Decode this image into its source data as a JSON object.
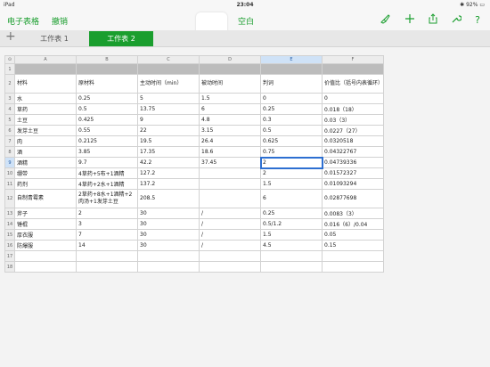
{
  "status": {
    "device": "iPad",
    "wifi": "wifi",
    "time": "23:04",
    "battery": "92%"
  },
  "toolbar": {
    "left_link": "电子表格",
    "undo": "撤销",
    "doc_title": "空白",
    "icons": [
      "brush-icon",
      "plus-icon",
      "share-icon",
      "wrench-icon",
      "help-icon"
    ]
  },
  "sheets": {
    "add": "+",
    "tabs": [
      {
        "label": "工作表 1"
      },
      {
        "label": "工作表 2"
      }
    ]
  },
  "columns": [
    "A",
    "B",
    "C",
    "D",
    "E",
    "F"
  ],
  "rows": [
    {
      "num": "1",
      "cells": [
        "",
        "",
        "",
        "",
        "",
        ""
      ]
    },
    {
      "num": "2",
      "cells": [
        "材料",
        "原材料",
        "主动时间（min）",
        "被动时间",
        "判词",
        "价值比（括号内表循环）"
      ]
    },
    {
      "num": "3",
      "cells": [
        "水",
        "0.25",
        "5",
        "1.5",
        "0",
        "0"
      ]
    },
    {
      "num": "4",
      "cells": [
        "草药",
        "0.5",
        "13.75",
        "6",
        "0.25",
        "0.018（18）"
      ]
    },
    {
      "num": "5",
      "cells": [
        "土豆",
        "0.425",
        "9",
        "4.8",
        "0.3",
        "0.03（3）"
      ]
    },
    {
      "num": "6",
      "cells": [
        "发芽土豆",
        "0.55",
        "22",
        "3.15",
        "0.5",
        "0.0227（27）"
      ]
    },
    {
      "num": "7",
      "cells": [
        "肉",
        "0.2125",
        "19.5",
        "26.4",
        "0.625",
        "0.0320518"
      ]
    },
    {
      "num": "8",
      "cells": [
        "酒",
        "3.85",
        "17.35",
        "18.6",
        "0.75",
        "0.04322767"
      ]
    },
    {
      "num": "9",
      "cells": [
        "酒精",
        "9.7",
        "42.2",
        "37.45",
        "2",
        "0.04739336"
      ]
    },
    {
      "num": "10",
      "cells": [
        "绷带",
        "4草药+5布+1酒精",
        "127.2",
        "",
        "2",
        "0.01572327"
      ]
    },
    {
      "num": "11",
      "cells": [
        "药剂",
        "4草药+2水+1酒精",
        "137.2",
        "",
        "1.5",
        "0.01093294"
      ]
    },
    {
      "num": "12",
      "cells": [
        "自制青霉素",
        "2草药+8水+1酒精+2肉汤+1发芽土豆",
        "208.5",
        "",
        "6",
        "0.02877698"
      ]
    },
    {
      "num": "13",
      "cells": [
        "斧子",
        "2",
        "30",
        "/",
        "0.25",
        "0.0083（3）"
      ]
    },
    {
      "num": "14",
      "cells": [
        "锤棍",
        "3",
        "30",
        "/",
        "0.5/1.2",
        "0.016（6）/0.04"
      ]
    },
    {
      "num": "15",
      "cells": [
        "厚衣服",
        "7",
        "30",
        "/",
        "1.5",
        "0.05"
      ]
    },
    {
      "num": "16",
      "cells": [
        "防爆服",
        "14",
        "30",
        "/",
        "4.5",
        "0.15"
      ]
    },
    {
      "num": "17",
      "cells": [
        "",
        "",
        "",
        "",
        "",
        ""
      ]
    },
    {
      "num": "18",
      "cells": [
        "",
        "",
        "",
        "",
        "",
        ""
      ]
    }
  ],
  "selected": {
    "row": "9",
    "column": "E",
    "value": "2"
  }
}
